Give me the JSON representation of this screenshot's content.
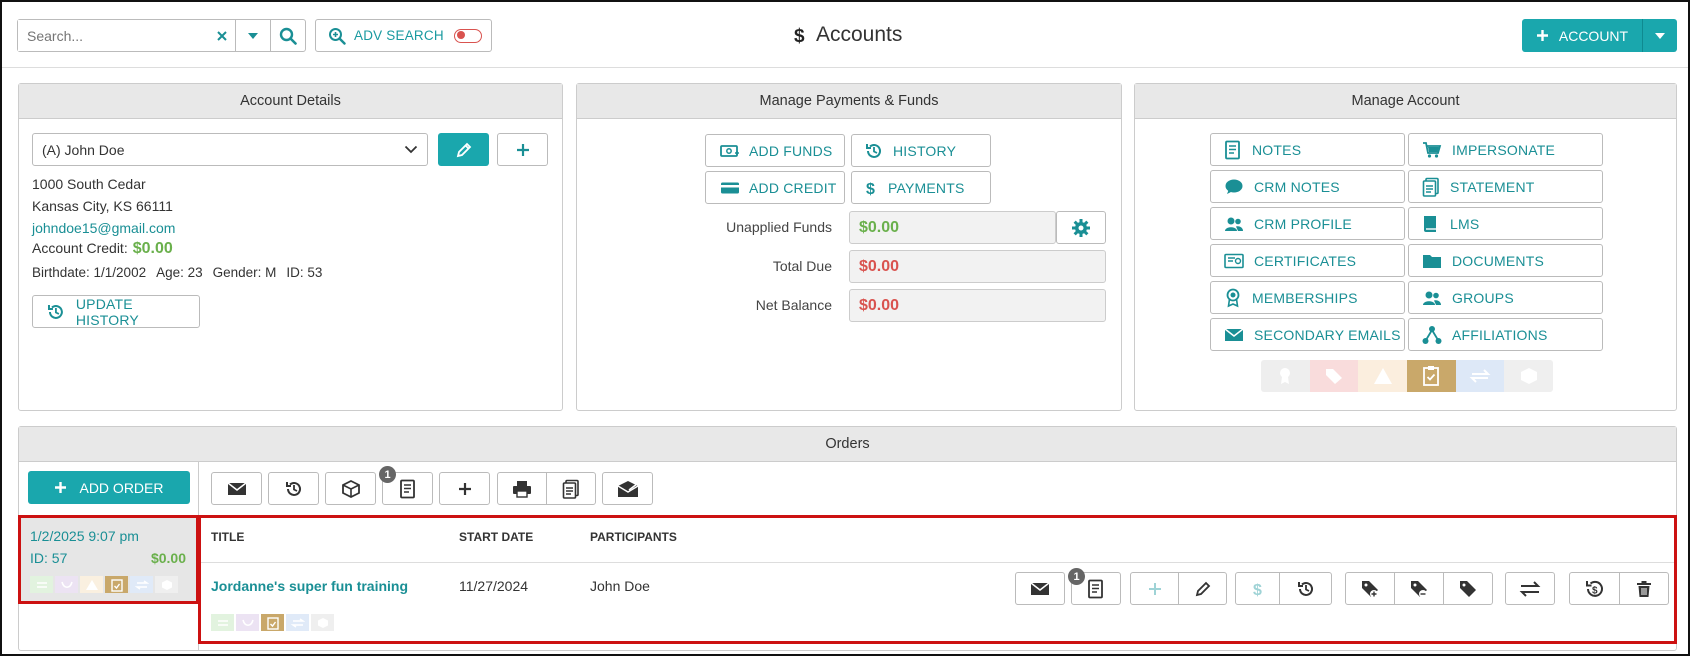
{
  "header": {
    "search_placeholder": "Search...",
    "adv_search_label": "ADV SEARCH",
    "page_title": "Accounts",
    "add_account_label": "ACCOUNT"
  },
  "account_details": {
    "title": "Account Details",
    "selected_account": "(A) John Doe",
    "address_line1": "1000 South Cedar",
    "address_line2": "Kansas City, KS 66111",
    "email": "johndoe15@gmail.com",
    "credit_label": "Account Credit:",
    "credit_value": "$0.00",
    "birthdate": "Birthdate: 1/1/2002",
    "age": "Age: 23",
    "gender": "Gender: M",
    "id": "ID: 53",
    "update_history_label": "UPDATE HISTORY"
  },
  "payments": {
    "title": "Manage Payments & Funds",
    "add_funds": "ADD FUNDS",
    "history": "HISTORY",
    "add_credit": "ADD CREDIT",
    "payments": "PAYMENTS",
    "unapplied_label": "Unapplied Funds",
    "unapplied_value": "$0.00",
    "total_due_label": "Total Due",
    "total_due_value": "$0.00",
    "net_balance_label": "Net Balance",
    "net_balance_value": "$0.00"
  },
  "manage_account": {
    "title": "Manage Account",
    "notes": "NOTES",
    "impersonate": "IMPERSONATE",
    "crm_notes": "CRM NOTES",
    "statement": "STATEMENT",
    "crm_profile": "CRM PROFILE",
    "lms": "LMS",
    "certificates": "CERTIFICATES",
    "documents": "DOCUMENTS",
    "memberships": "MEMBERSHIPS",
    "groups": "GROUPS",
    "secondary_emails": "SECONDARY EMAILS",
    "affiliations": "AFFILIATIONS"
  },
  "orders": {
    "title": "Orders",
    "add_order_label": "ADD ORDER",
    "notes_badge": "1",
    "order": {
      "date": "1/2/2025 9:07 pm",
      "id": "ID: 57",
      "amount": "$0.00"
    },
    "columns": {
      "title": "TITLE",
      "start_date": "START DATE",
      "participants": "PARTICIPANTS"
    },
    "row": {
      "title": "Jordanne's super fun training",
      "start_date": "11/27/2024",
      "participants": "John Doe",
      "notes_badge": "1"
    }
  },
  "colors": {
    "teal": "#1aa7ad",
    "green": "#6ab04c",
    "red": "#d9534f",
    "selection_border": "#cc1111"
  }
}
